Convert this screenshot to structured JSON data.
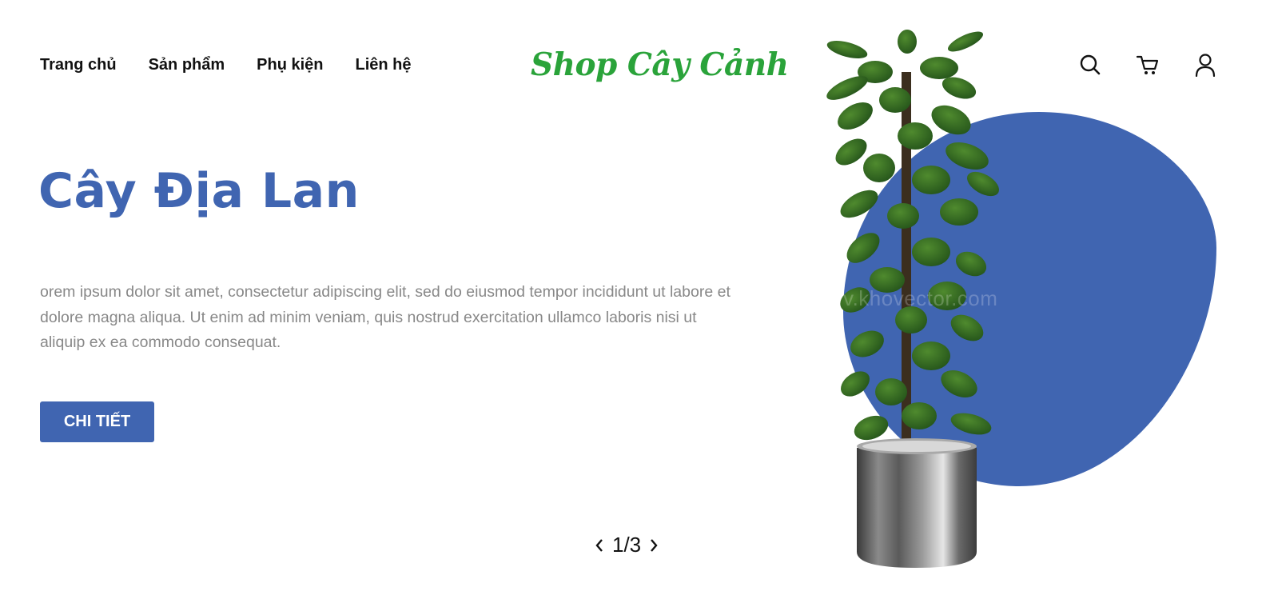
{
  "nav": {
    "items": [
      {
        "label": "Trang chủ"
      },
      {
        "label": "Sản phẩm"
      },
      {
        "label": "Phụ kiện"
      },
      {
        "label": "Liên hệ"
      }
    ]
  },
  "logo": {
    "text": "Shop Cây Cảnh"
  },
  "header_icons": [
    "search-icon",
    "cart-icon",
    "user-icon"
  ],
  "hero": {
    "title": "Cây Địa Lan",
    "description": "orem ipsum dolor sit amet, consectetur adipiscing elit, sed do eiusmod tempor incididunt ut labore et dolore magna aliqua. Ut enim ad minim veniam, quis nostrud exercitation ullamco laboris nisi ut aliquip ex ea commodo consequat.",
    "button_label": "CHI TIẾT",
    "watermark": "v.khovector.com"
  },
  "pager": {
    "current": "1",
    "separator": "/",
    "total": "3",
    "text": "1/3"
  },
  "colors": {
    "accent": "#4065b1",
    "logo": "#2aa33a",
    "text": "#111111",
    "muted": "#888888"
  }
}
